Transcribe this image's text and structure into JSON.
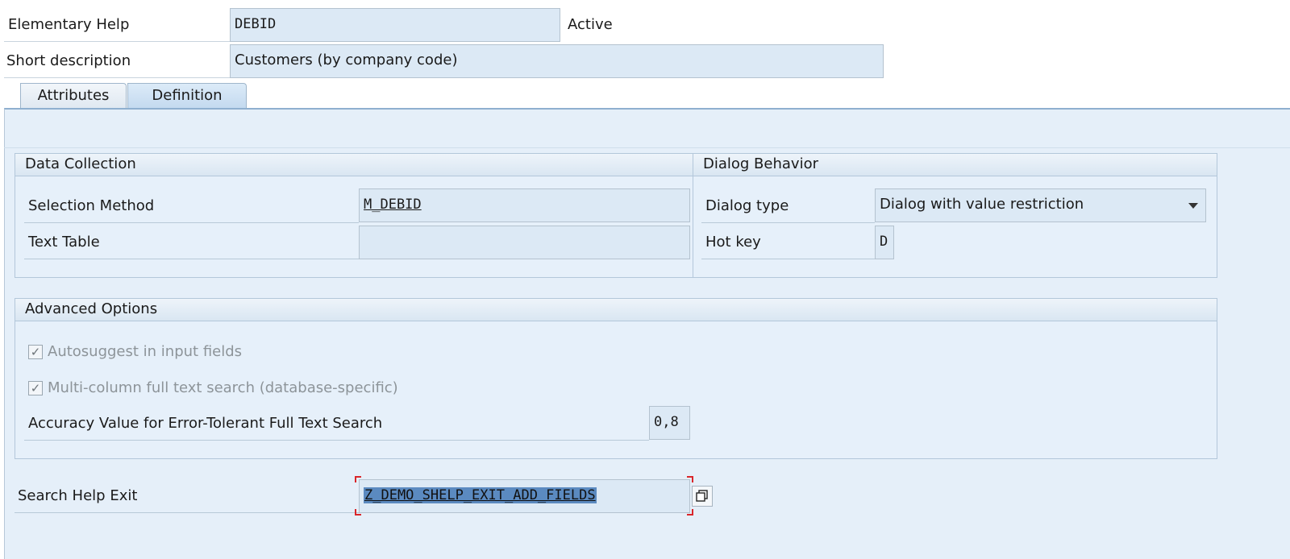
{
  "header": {
    "elementary_help_label": "Elementary Help",
    "elementary_help_value": "DEBID",
    "status": "Active",
    "short_description_label": "Short description",
    "short_description_value": "Customers (by company code)"
  },
  "tabs": [
    {
      "label": "Attributes",
      "active": false
    },
    {
      "label": "Definition",
      "active": true
    }
  ],
  "data_collection": {
    "title": "Data Collection",
    "selection_method_label": "Selection Method",
    "selection_method_value": "M_DEBID",
    "text_table_label": "Text Table",
    "text_table_value": ""
  },
  "dialog_behavior": {
    "title": "Dialog Behavior",
    "dialog_type_label": "Dialog type",
    "dialog_type_value": "Dialog with value restriction",
    "hot_key_label": "Hot key",
    "hot_key_value": "D"
  },
  "advanced_options": {
    "title": "Advanced Options",
    "autosuggest_label": "Autosuggest in input fields",
    "autosuggest_checked": true,
    "multicolumn_label": "Multi-column full text search (database-specific)",
    "multicolumn_checked": true,
    "accuracy_label": "Accuracy Value for Error-Tolerant Full Text Search",
    "accuracy_value": "0,8"
  },
  "search_help_exit": {
    "label": "Search Help Exit",
    "value": "Z_DEMO_SHELP_EXIT_ADD_FIELDS"
  },
  "checkmark_glyph": "✓",
  "icons": {
    "dropdown": "chevron-down-icon",
    "value_help": "copy-window-icon"
  },
  "colors": {
    "field_bg": "#dce9f5",
    "panel_bg": "#e5eff9",
    "focus_bracket": "#d9262b",
    "selection": "#5b8ac0"
  }
}
